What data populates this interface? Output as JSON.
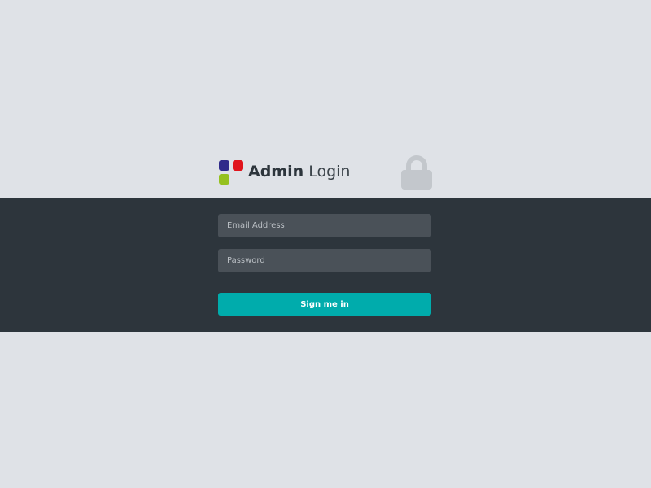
{
  "header": {
    "title_bold": "Admin",
    "title_light": "Login",
    "logo_icon": "four-squares-logo",
    "lock_icon": "lock-icon"
  },
  "form": {
    "email": {
      "value": "",
      "placeholder": "Email Address"
    },
    "password": {
      "value": "",
      "placeholder": "Password"
    },
    "submit_label": "Sign me in"
  },
  "colors": {
    "background": "#dfe2e7",
    "band": "#2d353c",
    "input_bg": "#4a5158",
    "accent": "#00acac",
    "logo_blue": "#2f2a8a",
    "logo_red": "#e0141c",
    "logo_green": "#95c11f",
    "lock": "#c3c7cc"
  }
}
